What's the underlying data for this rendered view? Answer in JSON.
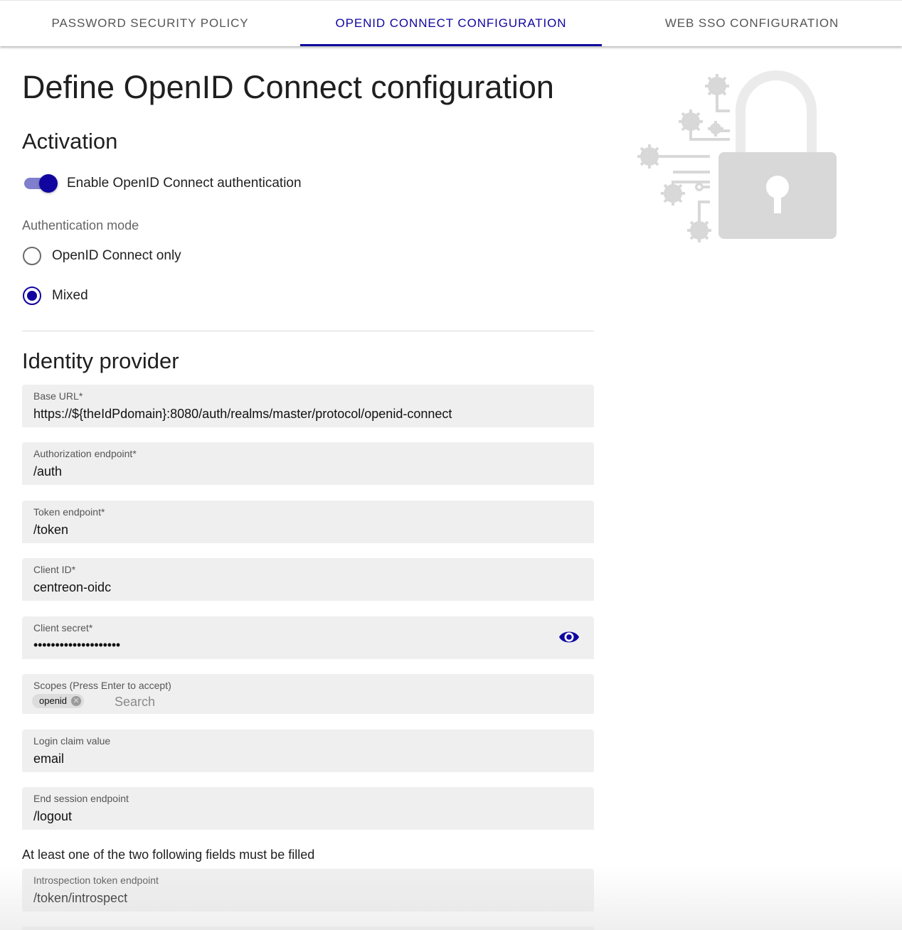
{
  "tabs": [
    {
      "label": "PASSWORD SECURITY POLICY",
      "active": false
    },
    {
      "label": "OPENID CONNECT CONFIGURATION",
      "active": true
    },
    {
      "label": "WEB SSO CONFIGURATION",
      "active": false
    }
  ],
  "page_title": "Define OpenID Connect configuration",
  "activation": {
    "title": "Activation",
    "toggle_label": "Enable OpenID Connect authentication",
    "toggle_on": true
  },
  "auth_mode": {
    "label": "Authentication mode",
    "options": [
      {
        "label": "OpenID Connect only",
        "checked": false
      },
      {
        "label": "Mixed",
        "checked": true
      }
    ]
  },
  "identity_provider": {
    "title": "Identity provider",
    "fields": [
      {
        "label": "Base URL",
        "required_mark": "*",
        "value": "https://${theIdPdomain}:8080/auth/realms/master/protocol/openid-connect"
      },
      {
        "label": "Authorization endpoint",
        "required_mark": "*",
        "value": "/auth"
      },
      {
        "label": "Token endpoint",
        "required_mark": "*",
        "value": "/token"
      },
      {
        "label": "Client ID",
        "required_mark": "*",
        "value": "centreon-oidc"
      },
      {
        "label": "Client secret",
        "required_mark": "*",
        "value": "••••••••••••••••••••",
        "icon": "eye-icon"
      },
      {
        "label": "Scopes (Press Enter to accept)",
        "chips": [
          "openid"
        ],
        "placeholder": "Search"
      },
      {
        "label": "Login claim value",
        "value": "email"
      },
      {
        "label": "End session endpoint",
        "value": "/logout"
      }
    ],
    "helper_text": "At least one of the two following fields must be filled",
    "introspection": {
      "label": "Introspection token endpoint",
      "value": "/token/introspect"
    }
  },
  "colors": {
    "accent": "#10069f",
    "accent_light": "#7f7fce",
    "field_bg": "#efefef",
    "illustration": "#d8d8d8"
  },
  "illustration": {
    "icon": "padlock-gears-icon"
  }
}
